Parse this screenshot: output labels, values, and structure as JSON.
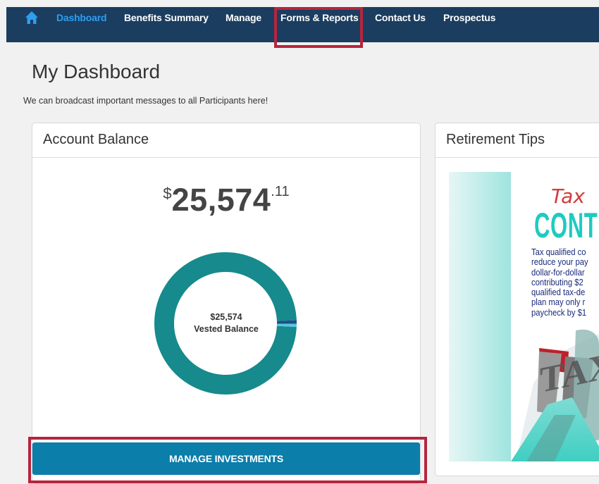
{
  "nav": {
    "items": [
      {
        "label": "Dashboard",
        "active": true
      },
      {
        "label": "Benefits Summary",
        "active": false
      },
      {
        "label": "Manage",
        "active": false
      },
      {
        "label": "Forms & Reports",
        "active": false
      },
      {
        "label": "Contact Us",
        "active": false
      },
      {
        "label": "Prospectus",
        "active": false
      }
    ],
    "home_icon": "home-icon"
  },
  "header": {
    "title": "My Dashboard",
    "broadcast": "We can broadcast important messages to all Participants here!"
  },
  "account_balance": {
    "title": "Account Balance",
    "currency": "$",
    "amount_main": "25,574",
    "amount_cents": ".11",
    "donut": {
      "center_amount": "$25,574",
      "center_label": "Vested Balance",
      "segments": [
        {
          "fraction": 0.985,
          "color": "#168a8d"
        },
        {
          "fraction": 0.008,
          "color": "#1d4f8a"
        },
        {
          "fraction": 0.007,
          "color": "#56c8e0"
        }
      ]
    },
    "button_label": "MANAGE INVESTMENTS"
  },
  "retirement_tips": {
    "title": "Retirement Tips",
    "image": {
      "heading": "Tax",
      "subheading": "CONT",
      "lines": [
        "Tax qualified co",
        "reduce your pay",
        "dollar-for-dollar",
        "contributing $2",
        "qualified tax-de",
        "plan may only r",
        "paycheck by $1"
      ],
      "graphic_text": "TAX"
    }
  },
  "colors": {
    "nav_bg": "#1b3d5f",
    "nav_active": "#2c9ff2",
    "highlight": "#b5253d",
    "button_bg": "#0b7eaa",
    "donut_main": "#168a8d"
  }
}
